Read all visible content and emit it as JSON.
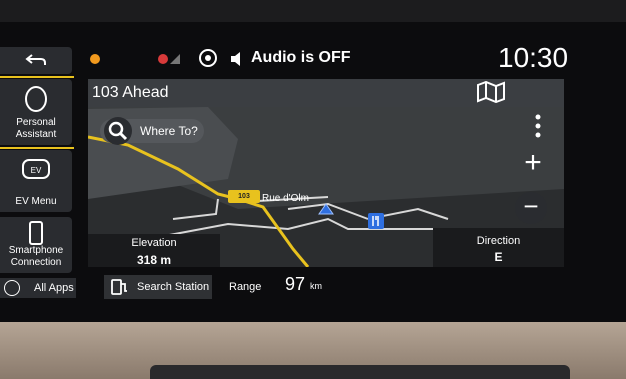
{
  "sidebar": {
    "items": [
      {
        "label": "",
        "icon": "back-arrow-icon"
      },
      {
        "label": "Personal Assistant",
        "icon": "assistant-icon"
      },
      {
        "label": "EV Menu",
        "icon": "ev-icon"
      },
      {
        "label": "Smartphone Connection",
        "icon": "phone-icon"
      }
    ]
  },
  "status": {
    "audio": "Audio is OFF",
    "time": "10:30"
  },
  "nav": {
    "ahead": "103 Ahead",
    "where_to": "Where To?",
    "road_shield": "103",
    "street": "Rue d'Olm",
    "elevation_label": "Elevation",
    "elevation_value": "318 m",
    "direction_label": "Direction",
    "direction_value": "E"
  },
  "bottom": {
    "all_apps": "All Apps",
    "search_station": "Search Station",
    "range_label": "Range",
    "range_value": "97",
    "range_unit": "km"
  },
  "colors": {
    "accent": "#e8c21e",
    "warning": "#f29a1e",
    "marker": "#2f6fe0",
    "poi": "#2f6fe0"
  }
}
